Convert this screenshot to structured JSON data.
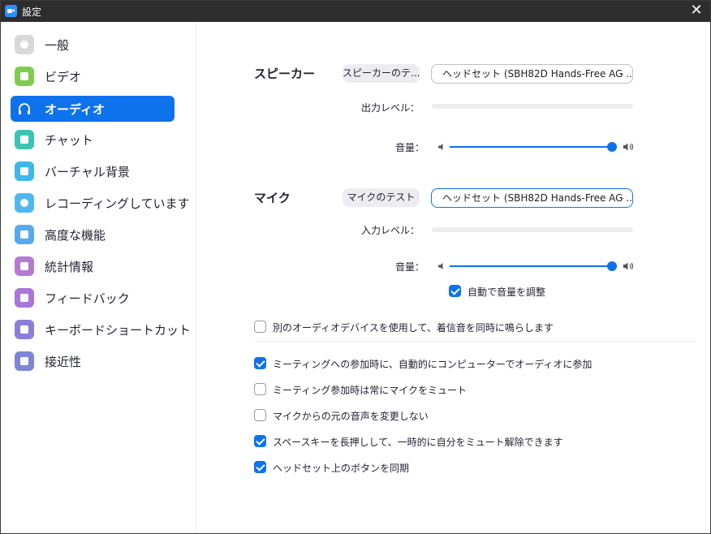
{
  "window": {
    "title": "設定",
    "close_glyph": "✕"
  },
  "sidebar": {
    "items": [
      {
        "label": "一般",
        "icon": "gear-icon",
        "active": false
      },
      {
        "label": "ビデオ",
        "icon": "video-camera-icon",
        "active": false
      },
      {
        "label": "オーディオ",
        "icon": "headphones-icon",
        "active": true
      },
      {
        "label": "チャット",
        "icon": "chat-bubble-icon",
        "active": false
      },
      {
        "label": "バーチャル背景",
        "icon": "virtual-background-icon",
        "active": false
      },
      {
        "label": "レコーディングしています",
        "icon": "record-icon",
        "active": false
      },
      {
        "label": "高度な機能",
        "icon": "sparkle-icon",
        "active": false
      },
      {
        "label": "統計情報",
        "icon": "bar-chart-icon",
        "active": false
      },
      {
        "label": "フィードバック",
        "icon": "smiley-icon",
        "active": false
      },
      {
        "label": "キーボードショートカット",
        "icon": "keyboard-icon",
        "active": false
      },
      {
        "label": "接近性",
        "icon": "accessibility-icon",
        "active": false
      }
    ]
  },
  "speaker": {
    "title": "スピーカー",
    "test_label": "スピーカーのテ...",
    "device": "ヘッドセット (SBH82D Hands-Free AG ...",
    "output_level_label": "出力レベル：",
    "volume_label": "音量：",
    "volume_fraction": 1.0
  },
  "mic": {
    "title": "マイク",
    "test_label": "マイクのテスト",
    "device": "ヘッドセット (SBH82D Hands-Free AG ...",
    "input_level_label": "入力レベル：",
    "volume_label": "音量：",
    "volume_fraction": 1.0,
    "auto_adjust_label": "自動で音量を調整",
    "auto_adjust_checked": true
  },
  "options": [
    {
      "label": "別のオーディオデバイスを使用して、着信音を同時に鳴らします",
      "checked": false
    },
    {
      "label": "ミーティングへの参加時に、自動的にコンピューターでオーディオに参加",
      "checked": true
    },
    {
      "label": "ミーティング参加時は常にマイクをミュート",
      "checked": false
    },
    {
      "label": "マイクからの元の音声を変更しない",
      "checked": false
    },
    {
      "label": "スペースキーを長押しして、一時的に自分をミュート解除できます",
      "checked": true
    },
    {
      "label": "ヘッドセット上のボタンを同期",
      "checked": true
    }
  ],
  "colors": {
    "accent": "#0e72ed",
    "titlebar": "#2d2d2d"
  }
}
